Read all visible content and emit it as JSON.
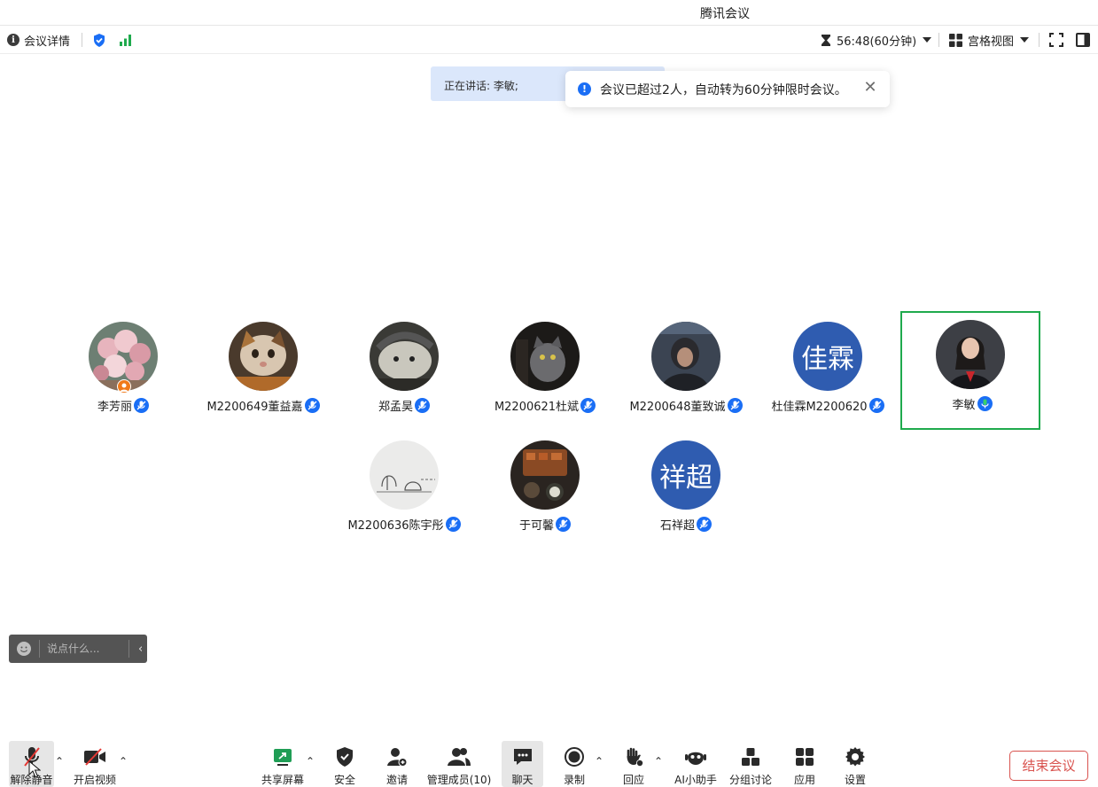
{
  "window": {
    "title": "腾讯会议"
  },
  "topbar": {
    "meeting_details": "会议详情",
    "timer": "56:48(60分钟)",
    "view_mode": "宫格视图"
  },
  "speaking": {
    "label": "正在讲话: 李敏;"
  },
  "notice": {
    "text": "会议已超过2人，自动转为60分钟限时会议。"
  },
  "participants": [
    {
      "name": "李芳丽",
      "avatar": "photo-flowers",
      "host": true
    },
    {
      "name": "M2200649董益嘉",
      "avatar": "photo-cat"
    },
    {
      "name": "郑孟昊",
      "avatar": "photo-gray-cat"
    },
    {
      "name": "M2200621杜斌",
      "avatar": "photo-black-cat"
    },
    {
      "name": "M2200648董致诚",
      "avatar": "photo-person-dark"
    },
    {
      "name": "杜佳霖M2200620",
      "avatar_text": "佳霖"
    },
    {
      "name": "李敏",
      "avatar": "photo-woman",
      "speaking": true
    },
    {
      "name": "M2200636陈宇彤",
      "avatar": "photo-sketch"
    },
    {
      "name": "于可馨",
      "avatar": "photo-food"
    },
    {
      "name": "石祥超",
      "avatar_text": "祥超"
    }
  ],
  "chat": {
    "placeholder": "说点什么..."
  },
  "toolbar": {
    "unmute": "解除静音",
    "start_video": "开启视频",
    "share_screen": "共享屏幕",
    "security": "安全",
    "invite": "邀请",
    "manage_members": "管理成员(10)",
    "chat": "聊天",
    "record": "录制",
    "react": "回应",
    "ai_assistant": "AI小助手",
    "breakout": "分组讨论",
    "apps": "应用",
    "settings": "设置",
    "end_meeting": "结束会议"
  },
  "colors": {
    "accent": "#1a6ef5",
    "speaking_border": "#1faa4d",
    "end_button": "#d9534f",
    "share_green": "#1f9d55",
    "signal_green": "#1faa4d"
  }
}
